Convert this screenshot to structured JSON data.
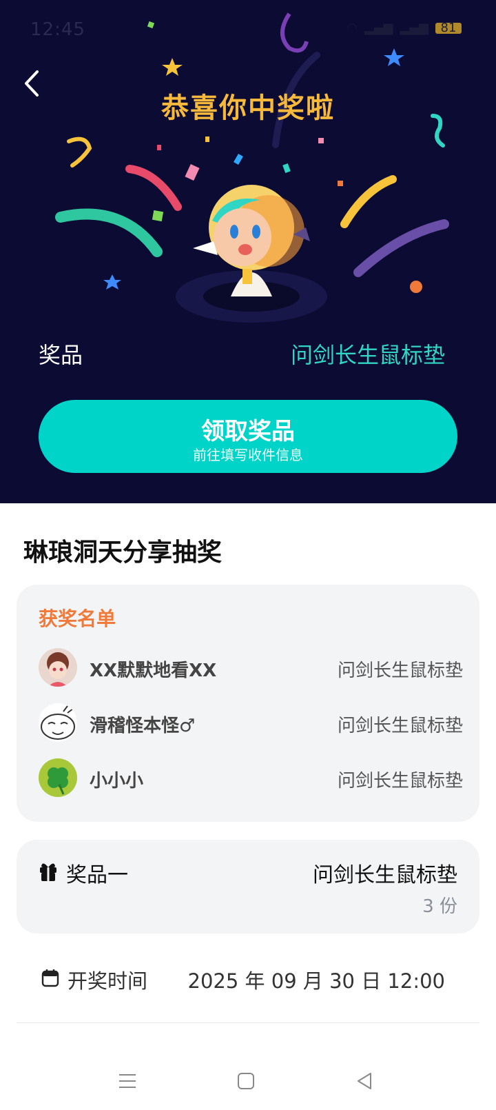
{
  "status_bar": {
    "time": "12:45",
    "battery": "81"
  },
  "hero": {
    "title": "恭喜你中奖啦",
    "prize_label": "奖品",
    "prize_value": "问剑长生鼠标垫",
    "claim_button": {
      "label": "领取奖品",
      "sublabel": "前往填写收件信息"
    }
  },
  "section": {
    "title": "琳琅洞天分享抽奖"
  },
  "winners": {
    "title": "获奖名单",
    "rows": [
      {
        "name": "XX默默地看XX",
        "prize": "问剑长生鼠标垫"
      },
      {
        "name": "滑稽怪本怪♂",
        "prize": "问剑长生鼠标垫"
      },
      {
        "name": "小小小",
        "prize": "问剑长生鼠标垫"
      }
    ]
  },
  "prize_info": {
    "label": "奖品一",
    "name": "问剑长生鼠标垫",
    "count": "3 份"
  },
  "draw": {
    "label": "开奖时间",
    "time": "2025 年 09 月 30 日 12:00"
  },
  "icons": {
    "back": "chevron-left-icon",
    "gift": "gift-icon",
    "calendar": "calendar-icon",
    "nav_menu": "menu-icon",
    "nav_home": "square-icon",
    "nav_back": "triangle-back-icon"
  },
  "colors": {
    "hero_bg": "#0b0b33",
    "title": "#f6b93b",
    "accent": "#00d4c8",
    "prize": "#30d6c3",
    "winners_title": "#f07a3a"
  }
}
